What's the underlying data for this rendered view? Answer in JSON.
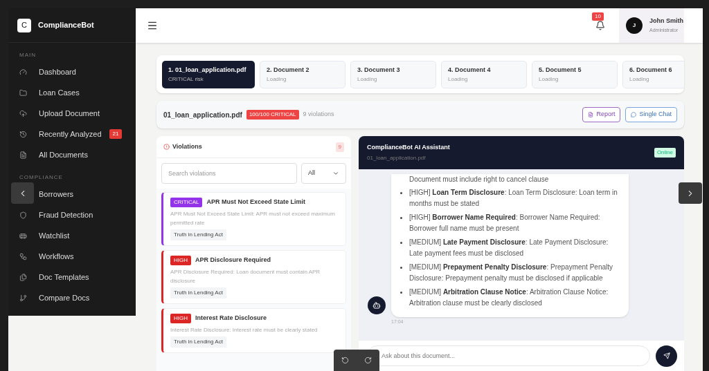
{
  "sidebar": {
    "brand": {
      "logo_letter": "C",
      "name": "ComplianceBot"
    },
    "sections": [
      {
        "label": "MAIN",
        "items": [
          {
            "label": "Dashboard"
          },
          {
            "label": "Loan Cases"
          },
          {
            "label": "Upload Document"
          },
          {
            "label": "Recently Analyzed",
            "badge": "21"
          },
          {
            "label": "All Documents"
          }
        ]
      },
      {
        "label": "COMPLIANCE",
        "items": [
          {
            "label": "Borrowers"
          },
          {
            "label": "Fraud Detection"
          },
          {
            "label": "Watchlist"
          },
          {
            "label": "Workflows"
          },
          {
            "label": "Doc Templates"
          },
          {
            "label": "Compare Docs"
          }
        ]
      }
    ]
  },
  "header": {
    "notification_count": "10",
    "user": {
      "initial": "J",
      "name": "John Smith",
      "role": "Administrator"
    }
  },
  "document_tabs": [
    {
      "title": "1. 01_loan_application.pdf",
      "status": "CRITICAL risk",
      "selected": true
    },
    {
      "title": "2. Document 2",
      "status": "Loading",
      "selected": false
    },
    {
      "title": "3. Document 3",
      "status": "Loading",
      "selected": false
    },
    {
      "title": "4. Document 4",
      "status": "Loading",
      "selected": false
    },
    {
      "title": "5. Document 5",
      "status": "Loading",
      "selected": false
    },
    {
      "title": "6. Document 6",
      "status": "Loading",
      "selected": false
    }
  ],
  "document_bar": {
    "file": "01_loan_application.pdf",
    "score": "100/100 CRITICAL",
    "violations": "9 violations",
    "buttons": [
      {
        "label": "Report",
        "kind": "report"
      },
      {
        "label": "Single Chat",
        "kind": "chat"
      }
    ]
  },
  "violations": {
    "title": "Violations",
    "count": "9",
    "search": {
      "placeholder": "Search violations"
    },
    "filter": "All",
    "items": [
      {
        "kind": "critical",
        "severity": "CRITICAL",
        "title": "APR Must Not Exceed State Limit",
        "description": "APR Must Not Exceed State Limit: APR must not exceed maximum permitted rate",
        "tag": "Truth in Lending Act"
      },
      {
        "kind": "high",
        "severity": "HIGH",
        "title": "APR Disclosure Required",
        "description": "APR Disclosure Required: Loan document must contain APR disclosure",
        "tag": "Truth in Lending Act"
      },
      {
        "kind": "high",
        "severity": "HIGH",
        "title": "Interest Rate Disclosure",
        "description": "Interest Rate Disclosure: Interest rate must be clearly stated",
        "tag": "Truth in Lending Act"
      }
    ]
  },
  "chat": {
    "title": "ComplianceBot AI Assistant",
    "subtitle": "01_loan_application.pdf",
    "status": "Online",
    "message": {
      "continued_text": "Document must include right to cancel clause",
      "items": [
        "[HIGH] **Loan Term Disclosure**: Loan Term Disclosure: Loan term in months must be stated",
        "[HIGH] **Borrower Name Required**: Borrower Name Required: Borrower full name must be present",
        "[MEDIUM] **Late Payment Disclosure**: Late Payment Disclosure: Late payment fees must be disclosed",
        "[MEDIUM] **Prepayment Penalty Disclosure**: Prepayment Penalty Disclosure: Prepayment penalty must be disclosed if applicable",
        "[MEDIUM] **Arbitration Clause Notice**: Arbitration Clause Notice: Arbitration clause must be clearly disclosed"
      ],
      "time": "17:04"
    },
    "input": {
      "placeholder": "Ask about this document..."
    }
  }
}
